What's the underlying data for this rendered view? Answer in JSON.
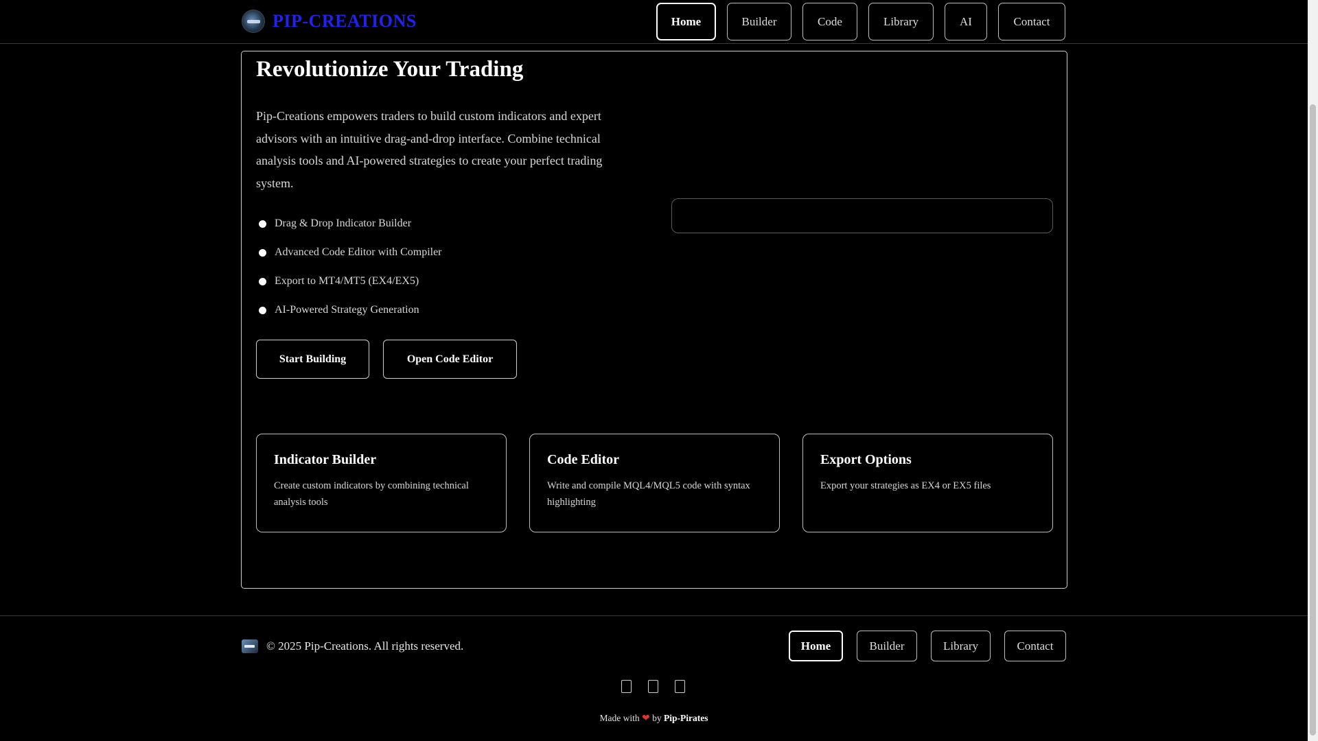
{
  "header": {
    "brand_name": "PIP-CREATIONS",
    "nav": [
      {
        "label": "Home",
        "active": true
      },
      {
        "label": "Builder"
      },
      {
        "label": "Code"
      },
      {
        "label": "Library"
      },
      {
        "label": "AI"
      },
      {
        "label": "Contact"
      }
    ]
  },
  "hero": {
    "title": "Revolutionize Your Trading",
    "description": "Pip-Creations empowers traders to build custom indicators and expert advisors with an intuitive drag-and-drop interface. Combine technical analysis tools and AI-powered strategies to create your perfect trading system.",
    "features": [
      "Drag & Drop Indicator Builder",
      "Advanced Code Editor with Compiler",
      "Export to MT4/MT5 (EX4/EX5)",
      "AI-Powered Strategy Generation"
    ],
    "start_button": "Start Building",
    "editor_button": "Open Code Editor"
  },
  "cards": [
    {
      "title": "Indicator Builder",
      "text": "Create custom indicators by combining technical analysis tools"
    },
    {
      "title": "Code Editor",
      "text": "Write and compile MQL4/MQL5 code with syntax highlighting"
    },
    {
      "title": "Export Options",
      "text": "Export your strategies as EX4 or EX5 files"
    }
  ],
  "footer": {
    "copyright": "© 2025 Pip-Creations. All rights reserved.",
    "nav": [
      {
        "label": "Home",
        "active": true
      },
      {
        "label": "Builder"
      },
      {
        "label": "Library"
      },
      {
        "label": "Contact"
      }
    ],
    "social_icons": [
      "social-icon-1",
      "social-icon-2",
      "social-icon-3"
    ],
    "made_with_prefix": "Made with",
    "heart": "❤",
    "made_with_by": "by",
    "author": "Pip-Pirates"
  },
  "colors": {
    "background": "#000000",
    "brand": "#2222ee",
    "heart": "#e0352b"
  }
}
